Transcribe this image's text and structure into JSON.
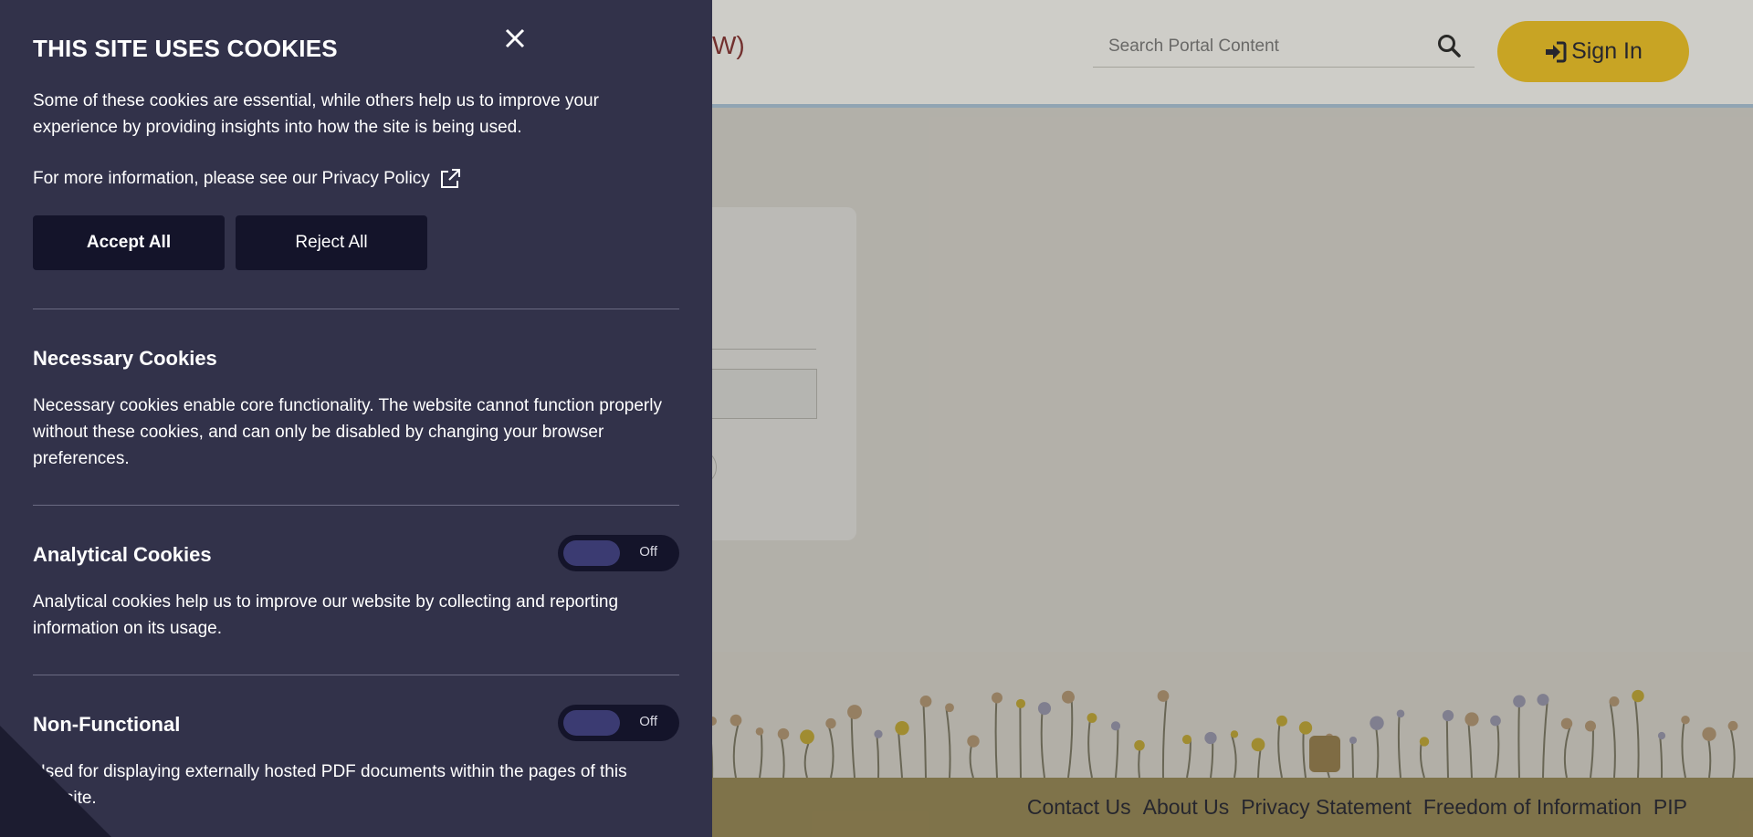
{
  "header": {
    "title_fragment": "W)",
    "search_placeholder": "Search Portal Content",
    "sign_in_label": "Sign In"
  },
  "footer": {
    "links": [
      "Contact Us",
      "About Us",
      "Privacy Statement",
      "Freedom of Information",
      "PIP"
    ]
  },
  "cookie_panel": {
    "title": "THIS SITE USES COOKIES",
    "intro": "Some of these cookies are essential, while others help us to improve your experience by providing insights into how the site is being used.",
    "more_info_prefix": "For more information, please see our",
    "privacy_link": "Privacy Policy",
    "accept_label": "Accept All",
    "reject_label": "Reject All",
    "sections": [
      {
        "title": "Necessary Cookies",
        "text": "Necessary cookies enable core functionality. The website cannot function properly without these cookies, and can only be disabled by changing your browser preferences."
      },
      {
        "title": "Analytical Cookies",
        "text": "Analytical cookies help us to improve our website by collecting and reporting information on its usage.",
        "toggle": "Off"
      },
      {
        "title": "Non-Functional",
        "text": "Used for displaying externally hosted PDF documents within the pages of this website.",
        "toggle": "Off"
      }
    ]
  },
  "colors": {
    "panel_bg": "#32324a",
    "button_bg": "#14142a",
    "sign_in_bg": "#e3b81e",
    "footer_bg": "#8a7c4c"
  },
  "icons": [
    "search-icon",
    "sign-in-icon",
    "close-icon",
    "external-link-icon"
  ]
}
